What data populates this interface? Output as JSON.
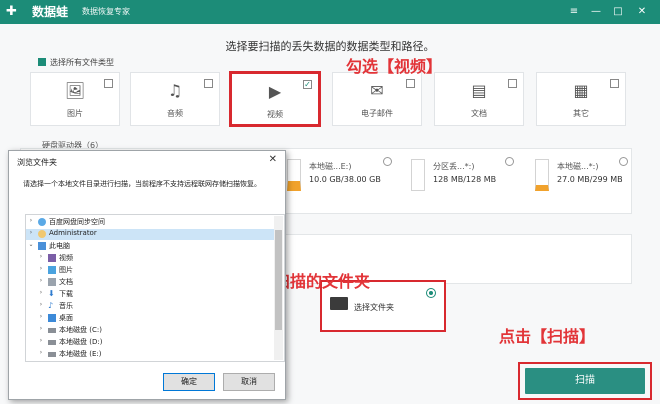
{
  "titlebar": {
    "app_name": "数据蛙",
    "sub_name": "数据恢复专家",
    "controls": [
      "≡",
      "—",
      "□",
      "✕"
    ]
  },
  "main": {
    "prompt": "选择要扫描的丢失数据的数据类型和路径。",
    "select_all_label": "选择所有文件类型",
    "file_types": [
      {
        "label": "图片",
        "icon": "image-icon",
        "checked": false
      },
      {
        "label": "音频",
        "icon": "audio-icon",
        "checked": false
      },
      {
        "label": "视频",
        "icon": "video-icon",
        "checked": true
      },
      {
        "label": "电子邮件",
        "icon": "mail-icon",
        "checked": false
      },
      {
        "label": "文档",
        "icon": "document-icon",
        "checked": false
      },
      {
        "label": "其它",
        "icon": "apps-icon",
        "checked": false
      }
    ],
    "hard_drive_section": "硬盘驱动器（6）",
    "drives": [
      {
        "name": "本地磁...E:)",
        "size": "10.0 GB/38.00 GB"
      },
      {
        "name": "分区丢...*:)",
        "size": "128 MB/128 MB"
      },
      {
        "name": "本地磁...*:)",
        "size": "27.0 MB/299 MB"
      }
    ],
    "select_folder_label": "选择文件夹",
    "scan_button": "扫描"
  },
  "annotations": {
    "video": "勾选【视频】",
    "folder": "选择需要扫描的文件夹",
    "scan": "点击【扫描】"
  },
  "dialog": {
    "title": "浏览文件夹",
    "description": "请选择一个本地文件目录进行扫描，当前程序不支持远程联网存储扫描恢复。",
    "tree": [
      {
        "label": "百度网盘同步空间",
        "level": 0,
        "icon": "cloud-icon"
      },
      {
        "label": "Administrator",
        "level": 0,
        "icon": "user-icon"
      },
      {
        "label": "此电脑",
        "level": 0,
        "icon": "computer-icon"
      },
      {
        "label": "视频",
        "level": 1,
        "icon": "video-folder-icon"
      },
      {
        "label": "图片",
        "level": 1,
        "icon": "picture-folder-icon"
      },
      {
        "label": "文档",
        "level": 1,
        "icon": "document-folder-icon"
      },
      {
        "label": "下载",
        "level": 1,
        "icon": "download-icon"
      },
      {
        "label": "音乐",
        "level": 1,
        "icon": "music-icon"
      },
      {
        "label": "桌面",
        "level": 1,
        "icon": "desktop-icon"
      },
      {
        "label": "本地磁盘 (C:)",
        "level": 1,
        "icon": "disk-icon"
      },
      {
        "label": "本地磁盘 (D:)",
        "level": 1,
        "icon": "disk-icon"
      },
      {
        "label": "本地磁盘 (E:)",
        "level": 1,
        "icon": "disk-icon"
      }
    ],
    "ok_button": "确定",
    "cancel_button": "取消",
    "close_glyph": "✕"
  },
  "colors": {
    "brand": "#1c8c78",
    "scan_button": "#2a8f82",
    "annotation": "#e23438"
  }
}
